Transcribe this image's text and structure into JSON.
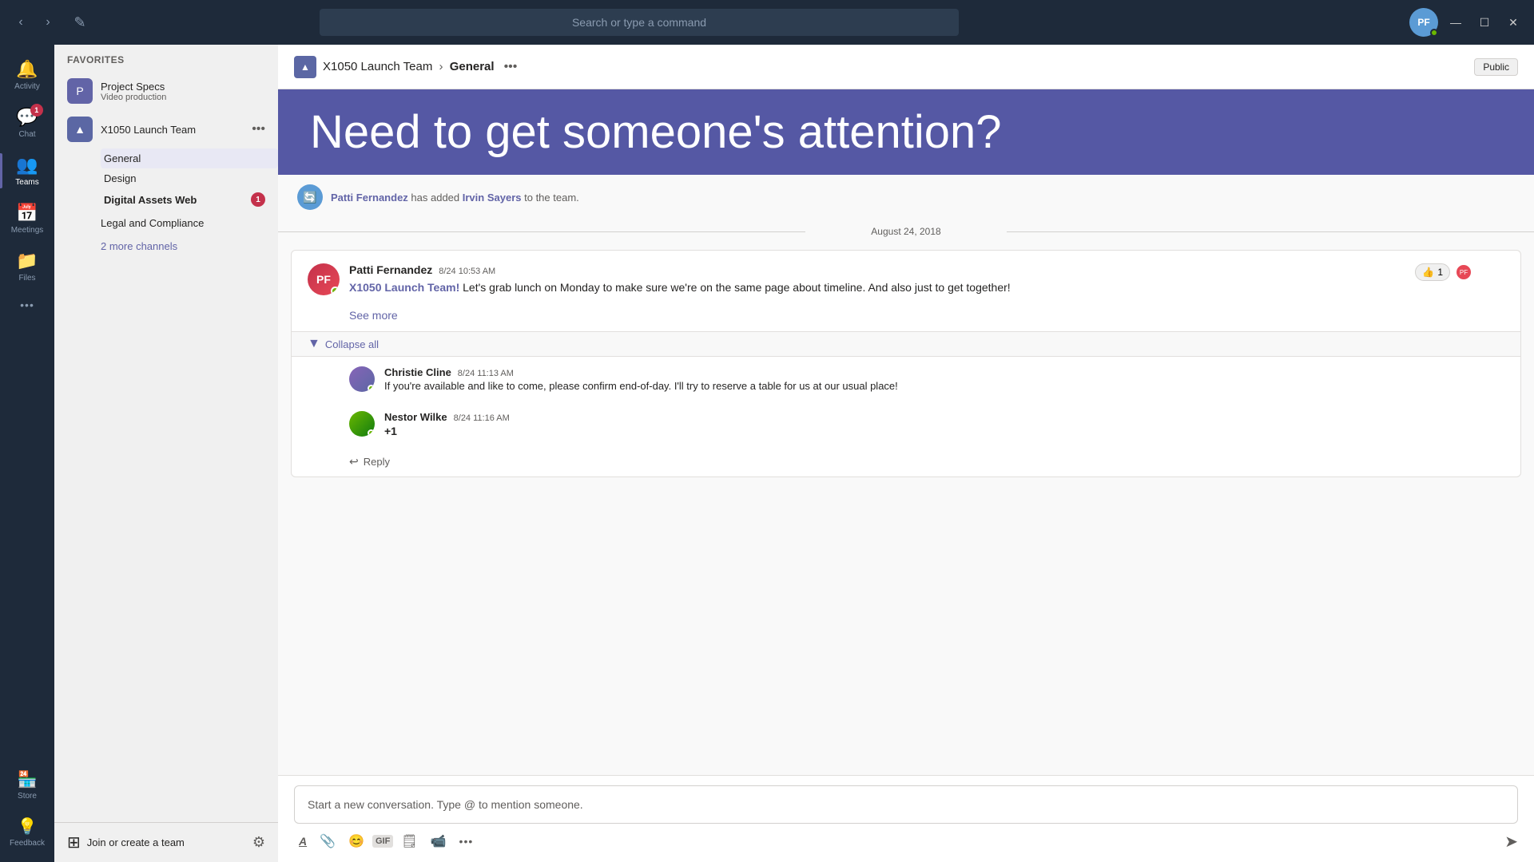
{
  "titlebar": {
    "search_placeholder": "Search or type a command",
    "nav_back": "‹",
    "nav_forward": "›",
    "compose_icon": "✎",
    "minimize": "—",
    "maximize": "☐",
    "close": "✕"
  },
  "rail": {
    "items": [
      {
        "id": "activity",
        "label": "Activity",
        "icon": "🔔",
        "active": false,
        "badge": null
      },
      {
        "id": "chat",
        "label": "Chat",
        "icon": "💬",
        "active": false,
        "badge": "1"
      },
      {
        "id": "teams",
        "label": "Teams",
        "icon": "👥",
        "active": true,
        "badge": null
      },
      {
        "id": "meetings",
        "label": "Meetings",
        "icon": "📅",
        "active": false,
        "badge": null
      },
      {
        "id": "files",
        "label": "Files",
        "icon": "📁",
        "active": false,
        "badge": null
      }
    ],
    "more": "•••",
    "store": {
      "label": "Store",
      "icon": "🏪"
    },
    "feedback": {
      "label": "Feedback",
      "icon": "💡"
    }
  },
  "sidebar": {
    "favorites_label": "Favorites",
    "teams": [
      {
        "id": "project-specs",
        "name": "Project Specs",
        "sub": "Video production",
        "icon": "P",
        "has_channels": false
      },
      {
        "id": "x1050",
        "name": "X1050 Launch Team",
        "icon": "X",
        "more_icon": "•••",
        "channels": [
          {
            "id": "general",
            "name": "General",
            "active": true,
            "badge": null
          },
          {
            "id": "design",
            "name": "Design",
            "active": false,
            "badge": null
          },
          {
            "id": "digital-assets-web",
            "name": "Digital Assets Web",
            "active": false,
            "badge": "1",
            "bold": true
          }
        ]
      }
    ],
    "legal_and_compliance": "Legal and Compliance",
    "more_channels": "2 more channels",
    "join_btn": "Join or create a team",
    "join_icon": "⊞",
    "settings_icon": "⚙"
  },
  "channel": {
    "team_name": "X1050 Launch Team",
    "channel_name": "General",
    "separator": "›",
    "dots": "•••",
    "public_label": "Public",
    "team_icon": "X"
  },
  "banner": {
    "text": "Need to get someone's attention?"
  },
  "messages": {
    "system_event": {
      "text_prefix": "",
      "sender": "Patti Fernandez",
      "text_middle": "has added",
      "added_user": "Irvin Sayers",
      "text_suffix": "to the team."
    },
    "date_divider": "August 24, 2018",
    "main_message": {
      "sender": "Patti Fernandez",
      "time": "8/24 10:53 AM",
      "mention": "X1050 Launch Team!",
      "text": "Let's grab lunch on Monday to make sure we're on the same page about timeline. And also just to get together!",
      "reaction_count": "1",
      "see_more": "See more",
      "collapse_all": "Collapse all"
    },
    "replies": [
      {
        "id": "reply-1",
        "sender": "Christie Cline",
        "time": "8/24 11:13 AM",
        "text": "If you're available and like to come, please confirm end-of-day. I'll try to reserve a table for us at our usual place!",
        "status": "offline"
      },
      {
        "id": "reply-2",
        "sender": "Nestor Wilke",
        "time": "8/24 11:16 AM",
        "text": "+1",
        "status": "online"
      }
    ],
    "reply_action": "Reply"
  },
  "compose": {
    "placeholder": "Start a new conversation. Type @ to mention someone.",
    "toolbar": {
      "format": "A",
      "attach": "📎",
      "emoji": "😊",
      "gif": "GIF",
      "sticker": "🗒",
      "video": "📹",
      "more": "•••"
    }
  }
}
